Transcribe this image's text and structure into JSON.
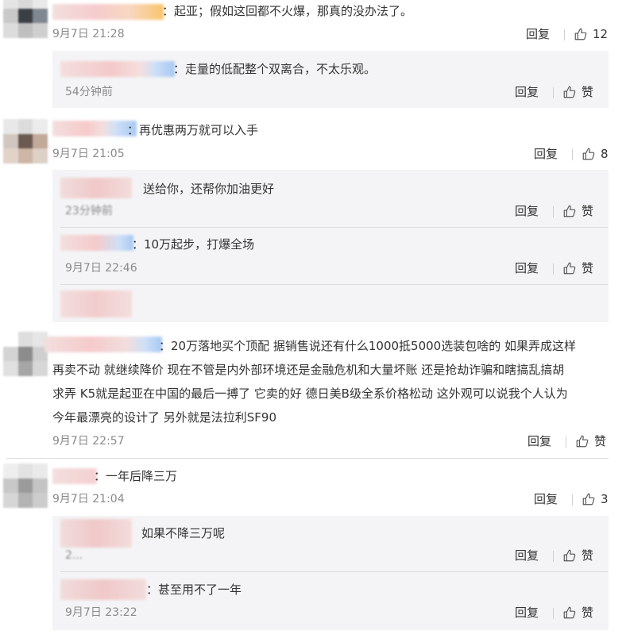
{
  "comments": [
    {
      "text": "：起亚；假如这回都不火爆，那真的没办法了。",
      "time": "9月7日 21:28",
      "reply": "回复",
      "likes": "12",
      "replies": [
        {
          "text": "：走量的低配整个双离合，不太乐观。",
          "time": "54分钟前",
          "reply": "回复",
          "likes": "赞"
        }
      ]
    },
    {
      "text": "：再优惠两万就可以入手",
      "time": "9月7日 21:05",
      "reply": "回复",
      "likes": "8",
      "replies": [
        {
          "text": "送给你，还帮你加油更好",
          "time": "23分钟前",
          "reply": "回复",
          "likes": "赞"
        },
        {
          "text": "：10万起步，打爆全场",
          "time": "9月7日 22:46",
          "reply": "回复",
          "likes": "赞"
        }
      ]
    },
    {
      "lines": [
        "：20万落地买个顶配 据销售说还有什么1000抵5000选装包啥的 如果弄成这样",
        "再卖不动 就继续降价 现在不管是内外部环境还是金融危机和大量坏账 还是抢劫诈骗和瞎搞乱搞胡",
        "求弄 K5就是起亚在中国的最后一搏了 它卖的好 德日美B级全系价格松动 这外观可以说我个人认为",
        "今年最漂亮的设计了 另外就是法拉利SF90"
      ],
      "time": "9月7日 22:57",
      "reply": "回复",
      "likes": "赞"
    },
    {
      "text": "：一年后降三万",
      "time": "9月7日 21:04",
      "reply": "回复",
      "likes": "3",
      "replies": [
        {
          "text": "如果不降三万呢",
          "time": "2...",
          "reply": "回复",
          "likes": "赞"
        },
        {
          "text": "：甚至用不了一年",
          "time": "9月7日 23:22",
          "reply": "回复",
          "likes": "赞"
        }
      ]
    }
  ],
  "colors": {
    "reply_bg": "#f4f4f6",
    "time": "#8a8a8a",
    "text": "#333333",
    "divider": "#dcdcdc"
  },
  "icons": {
    "like": "thumbs-up-icon"
  }
}
